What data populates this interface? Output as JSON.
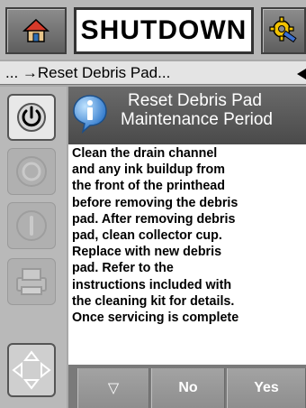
{
  "header": {
    "status": "SHUTDOWN",
    "home_icon": "home-icon",
    "tools_icon": "gear-wrench-icon"
  },
  "breadcrumb": {
    "text": "... →Reset Debris Pad..."
  },
  "sidebar": {
    "items": [
      {
        "icon": "power-icon",
        "state": "active"
      },
      {
        "icon": "stop-circle-icon",
        "state": "disabled"
      },
      {
        "icon": "start-line-icon",
        "state": "disabled"
      },
      {
        "icon": "printer-icon",
        "state": "disabled"
      },
      {
        "icon": "nav-arrows-icon",
        "state": "active"
      }
    ]
  },
  "dialog": {
    "icon": "info-icon",
    "title_line1": "Reset Debris Pad",
    "title_line2": "Maintenance Period",
    "body_lines": [
      "Clean the drain channel",
      "and any ink buildup from",
      "the front of the printhead",
      "before removing the debris",
      "pad. After removing debris",
      "pad, clean collector cup.",
      "Replace with new debris",
      "pad. Refer to the",
      "instructions included with",
      "the cleaning kit for details.",
      "Once servicing is complete"
    ]
  },
  "footer": {
    "scroll_down_label": "▽",
    "no_label": "No",
    "yes_label": "Yes"
  },
  "colors": {
    "header_bg": "#5a5a5a",
    "button_bg": "#999999",
    "text": "#000000"
  }
}
